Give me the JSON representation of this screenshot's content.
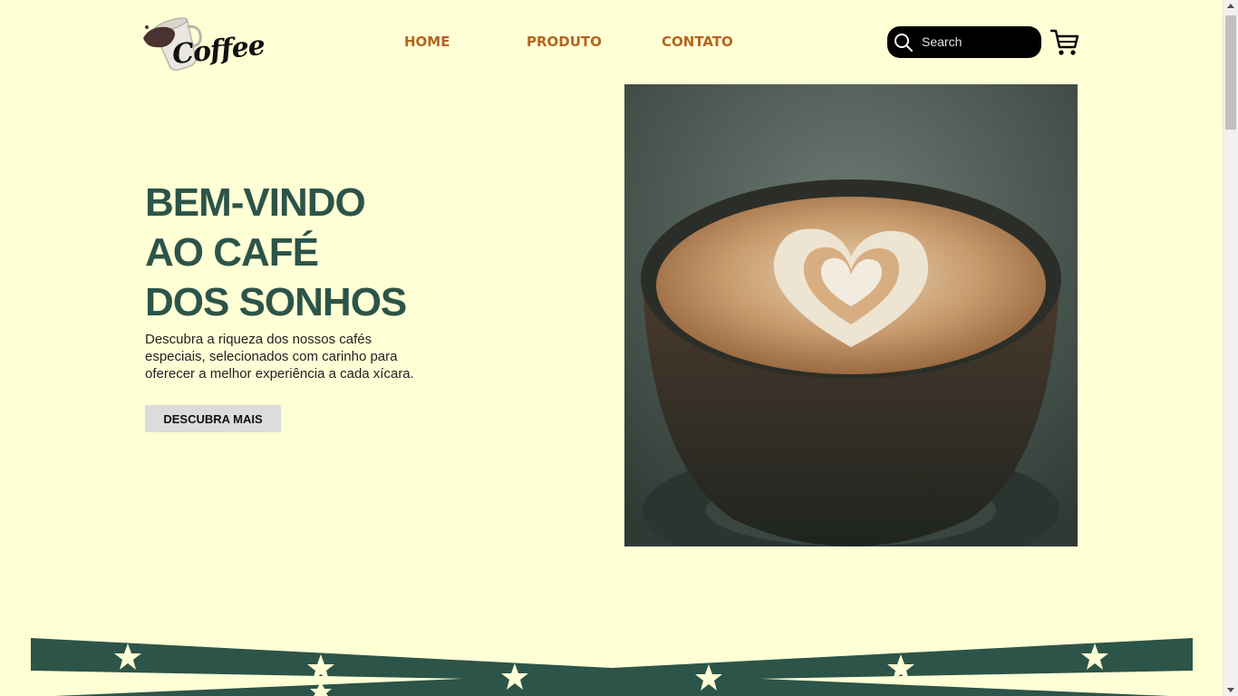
{
  "brand": {
    "logo_text": "Coffee"
  },
  "nav": {
    "home": "HOME",
    "produto": "PRODUTO",
    "contato": "CONTATO"
  },
  "search": {
    "placeholder": "Search"
  },
  "hero": {
    "title_lines": [
      "BEM-VINDO",
      "AO CAFÉ",
      "DOS SONHOS"
    ],
    "description": "Descubra a riqueza dos nossos cafés especiais, selecionados com carinho para oferecer a melhor experiência a cada xícara.",
    "button_label": "DESCUBRA MAIS"
  },
  "colors": {
    "background": "#ffffd6",
    "accent_green": "#2c5448",
    "nav_orange": "#b5651d"
  },
  "icons": [
    "coffee-cup-logo",
    "search-icon",
    "cart-icon",
    "star-icon"
  ]
}
